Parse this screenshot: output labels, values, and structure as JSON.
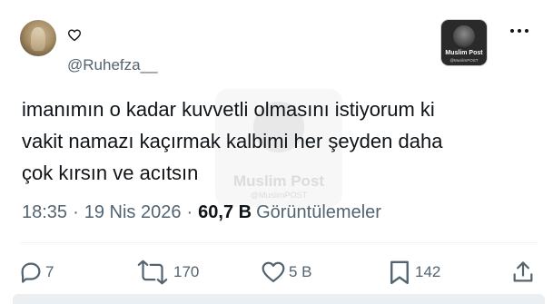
{
  "user": {
    "display_name": "",
    "handle": "@Ruhefza__"
  },
  "badge": {
    "name": "Muslim Post",
    "handle": "@MuslimPOST"
  },
  "watermark": {
    "name": "Muslim Post",
    "handle": "@MuslimPOST"
  },
  "tweet": {
    "lines": [
      "imanımın o kadar kuvvetli olmasını istiyorum ki",
      "vakit namazı kaçırmak kalbimi her şeyden daha",
      "çok kırsın ve acıtsın"
    ],
    "time": "18:35",
    "date": "19 Nis 2026",
    "separator": "·",
    "views_count": "60,7 B",
    "views_label": "Görüntülemeler"
  },
  "actions": {
    "replies": "7",
    "retweets": "170",
    "likes": "5 B",
    "bookmarks": "142"
  },
  "icons": {
    "heart": "heart-outline-icon",
    "more": "more-horizontal-icon",
    "reply": "reply-icon",
    "retweet": "retweet-icon",
    "like": "like-icon",
    "bookmark": "bookmark-icon",
    "share": "share-icon"
  }
}
